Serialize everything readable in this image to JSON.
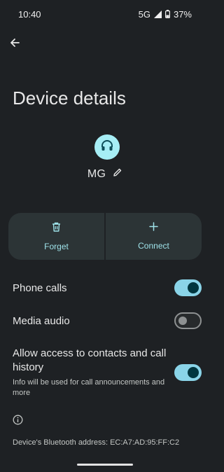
{
  "status_bar": {
    "time": "10:40",
    "network": "5G",
    "battery": "37%"
  },
  "header": {
    "title": "Device details"
  },
  "device": {
    "name": "MG",
    "icon": "headset-icon"
  },
  "actions": [
    {
      "label": "Forget",
      "icon": "trash-icon"
    },
    {
      "label": "Connect",
      "icon": "plus-icon"
    }
  ],
  "settings": {
    "phone_calls": {
      "label": "Phone calls",
      "enabled": true
    },
    "media_audio": {
      "label": "Media audio",
      "enabled": false
    },
    "contacts": {
      "label": "Allow access to contacts and call history",
      "sub": "Info will be used for call announcements and more",
      "enabled": true
    }
  },
  "footer": {
    "bt_address": "Device's Bluetooth address: EC:A7:AD:95:FF:C2"
  },
  "colors": {
    "accent": "#9fe3ea",
    "switch_on": "#8ad4e8",
    "avatar_bg": "#a6eef5",
    "background": "#1e2124"
  }
}
